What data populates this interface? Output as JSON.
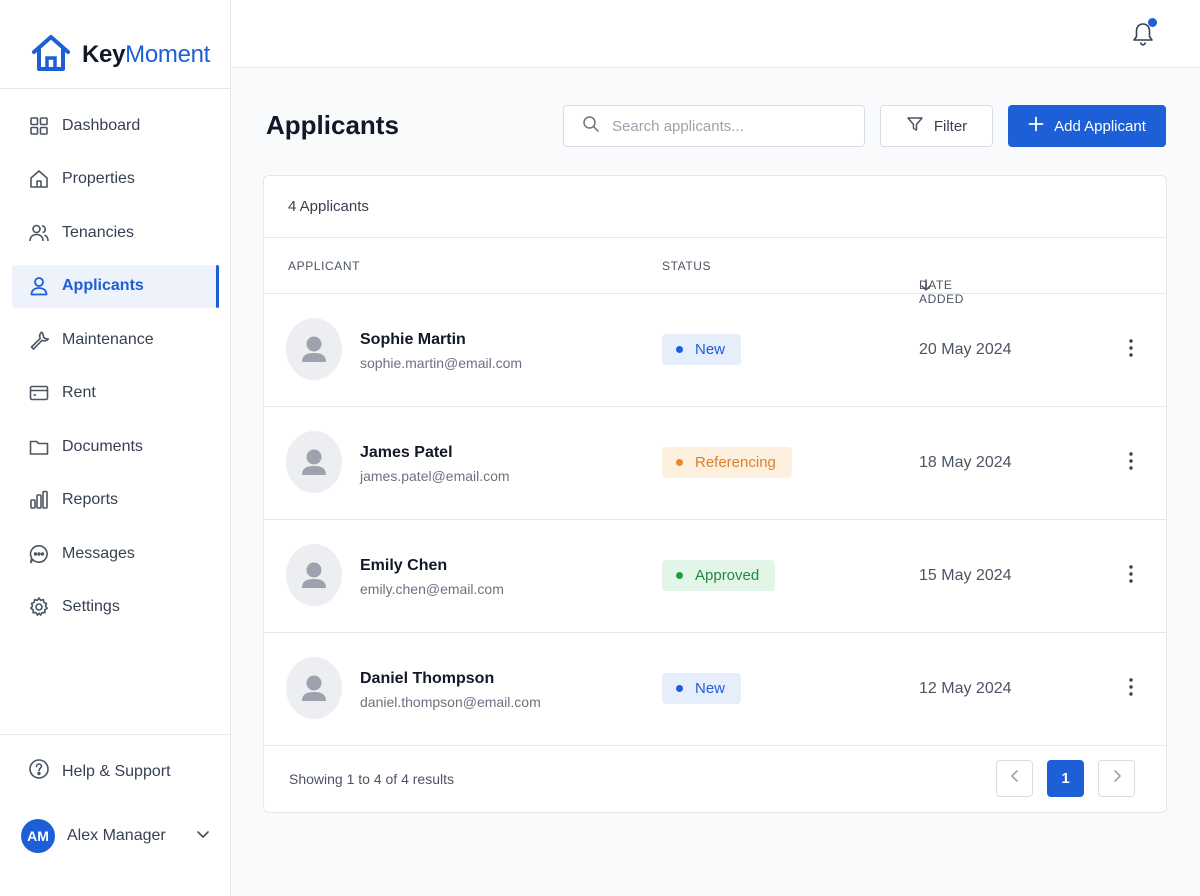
{
  "app": {
    "brand_part1": "Key",
    "brand_part2": "Moment",
    "accent": "#1d5fd6"
  },
  "sidebar": {
    "items": [
      {
        "label": "Dashboard",
        "icon": "grid-icon",
        "active": false
      },
      {
        "label": "Properties",
        "icon": "home-icon",
        "active": false
      },
      {
        "label": "Tenancies",
        "icon": "users-icon",
        "active": false
      },
      {
        "label": "Applicants",
        "icon": "user-icon",
        "active": true
      },
      {
        "label": "Maintenance",
        "icon": "wrench-icon",
        "active": false
      },
      {
        "label": "Rent",
        "icon": "card-icon",
        "active": false
      },
      {
        "label": "Documents",
        "icon": "folder-icon",
        "active": false
      },
      {
        "label": "Reports",
        "icon": "bar-chart-icon",
        "active": false
      },
      {
        "label": "Messages",
        "icon": "chat-icon",
        "active": false
      },
      {
        "label": "Settings",
        "icon": "gear-icon",
        "active": false
      }
    ],
    "help_label": "Help & Support",
    "user": {
      "initials": "AM",
      "name": "Alex Manager"
    }
  },
  "header": {
    "title": "Applicants",
    "search_placeholder": "Search applicants...",
    "filter_label": "Filter",
    "add_label": "Add Applicant"
  },
  "table": {
    "count_label": "4 Applicants",
    "columns": {
      "applicant": "APPLICANT",
      "status": "STATUS",
      "date": "DATE ADDED"
    },
    "rows": [
      {
        "name": "Sophie Martin",
        "email": "sophie.martin@email.com",
        "status": "New",
        "status_kind": "new",
        "date": "20 May 2024"
      },
      {
        "name": "James Patel",
        "email": "james.patel@email.com",
        "status": "Referencing",
        "status_kind": "referencing",
        "date": "18 May 2024"
      },
      {
        "name": "Emily Chen",
        "email": "emily.chen@email.com",
        "status": "Approved",
        "status_kind": "approved",
        "date": "15 May 2024"
      },
      {
        "name": "Daniel Thompson",
        "email": "daniel.thompson@email.com",
        "status": "New",
        "status_kind": "new",
        "date": "12 May 2024"
      }
    ],
    "status_colors": {
      "new": {
        "bg": "#e6edfb",
        "fg": "#1d5fd6",
        "dot": "#1d5fd6"
      },
      "referencing": {
        "bg": "#fdf0de",
        "fg": "#d9822b",
        "dot": "#e8892c"
      },
      "approved": {
        "bg": "#e3f5e8",
        "fg": "#1f8a3d",
        "dot": "#1f9a45"
      }
    }
  },
  "footer": {
    "showing": "Showing 1 to 4 of 4 results",
    "current_page": "1"
  }
}
